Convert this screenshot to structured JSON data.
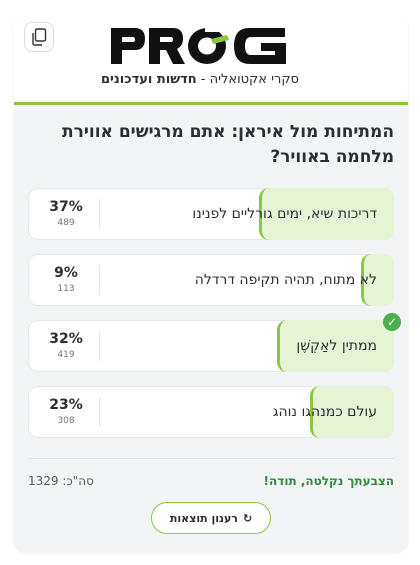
{
  "header": {
    "brand": "PROG",
    "tagline_light": "סקרי אקטואליה - ",
    "tagline_bold": "חדשות ועדכונים",
    "copy_icon": "copy-icon",
    "brand_colors": {
      "dark": "#111111",
      "accent": "#8cc63f"
    }
  },
  "poll": {
    "question": "המתיחות מול איראן: אתם מרגישים אווירת מלחמה באוויר?",
    "options": [
      {
        "label": "דריכות שיא, ימים גורליים לפנינו",
        "percent_label": "37%",
        "percent": 37,
        "count": "489",
        "selected": false
      },
      {
        "label": "לא מתוח, תהיה תקיפה דרדלה",
        "percent_label": "9%",
        "percent": 9,
        "count": "113",
        "selected": false
      },
      {
        "label": "ממתין לאַקְשֶׁן",
        "percent_label": "32%",
        "percent": 32,
        "count": "419",
        "selected": true
      },
      {
        "label": "עולם כמנהגו נוהג",
        "percent_label": "23%",
        "percent": 23,
        "count": "308",
        "selected": false
      }
    ],
    "selected_icon": "checkmark-icon",
    "voted_message": "הצבעתך נקלטה, תודה!",
    "total": "סה\"כ: 1329",
    "refresh_label": "רענון תוצאות",
    "refresh_icon_glyph": "↻"
  },
  "colors": {
    "accent_green": "#8cc63f",
    "fill_green": "#e6f4d6",
    "success_green": "#4caf50",
    "message_green": "#2e8b3a",
    "card_bg": "#f3f4f6"
  }
}
